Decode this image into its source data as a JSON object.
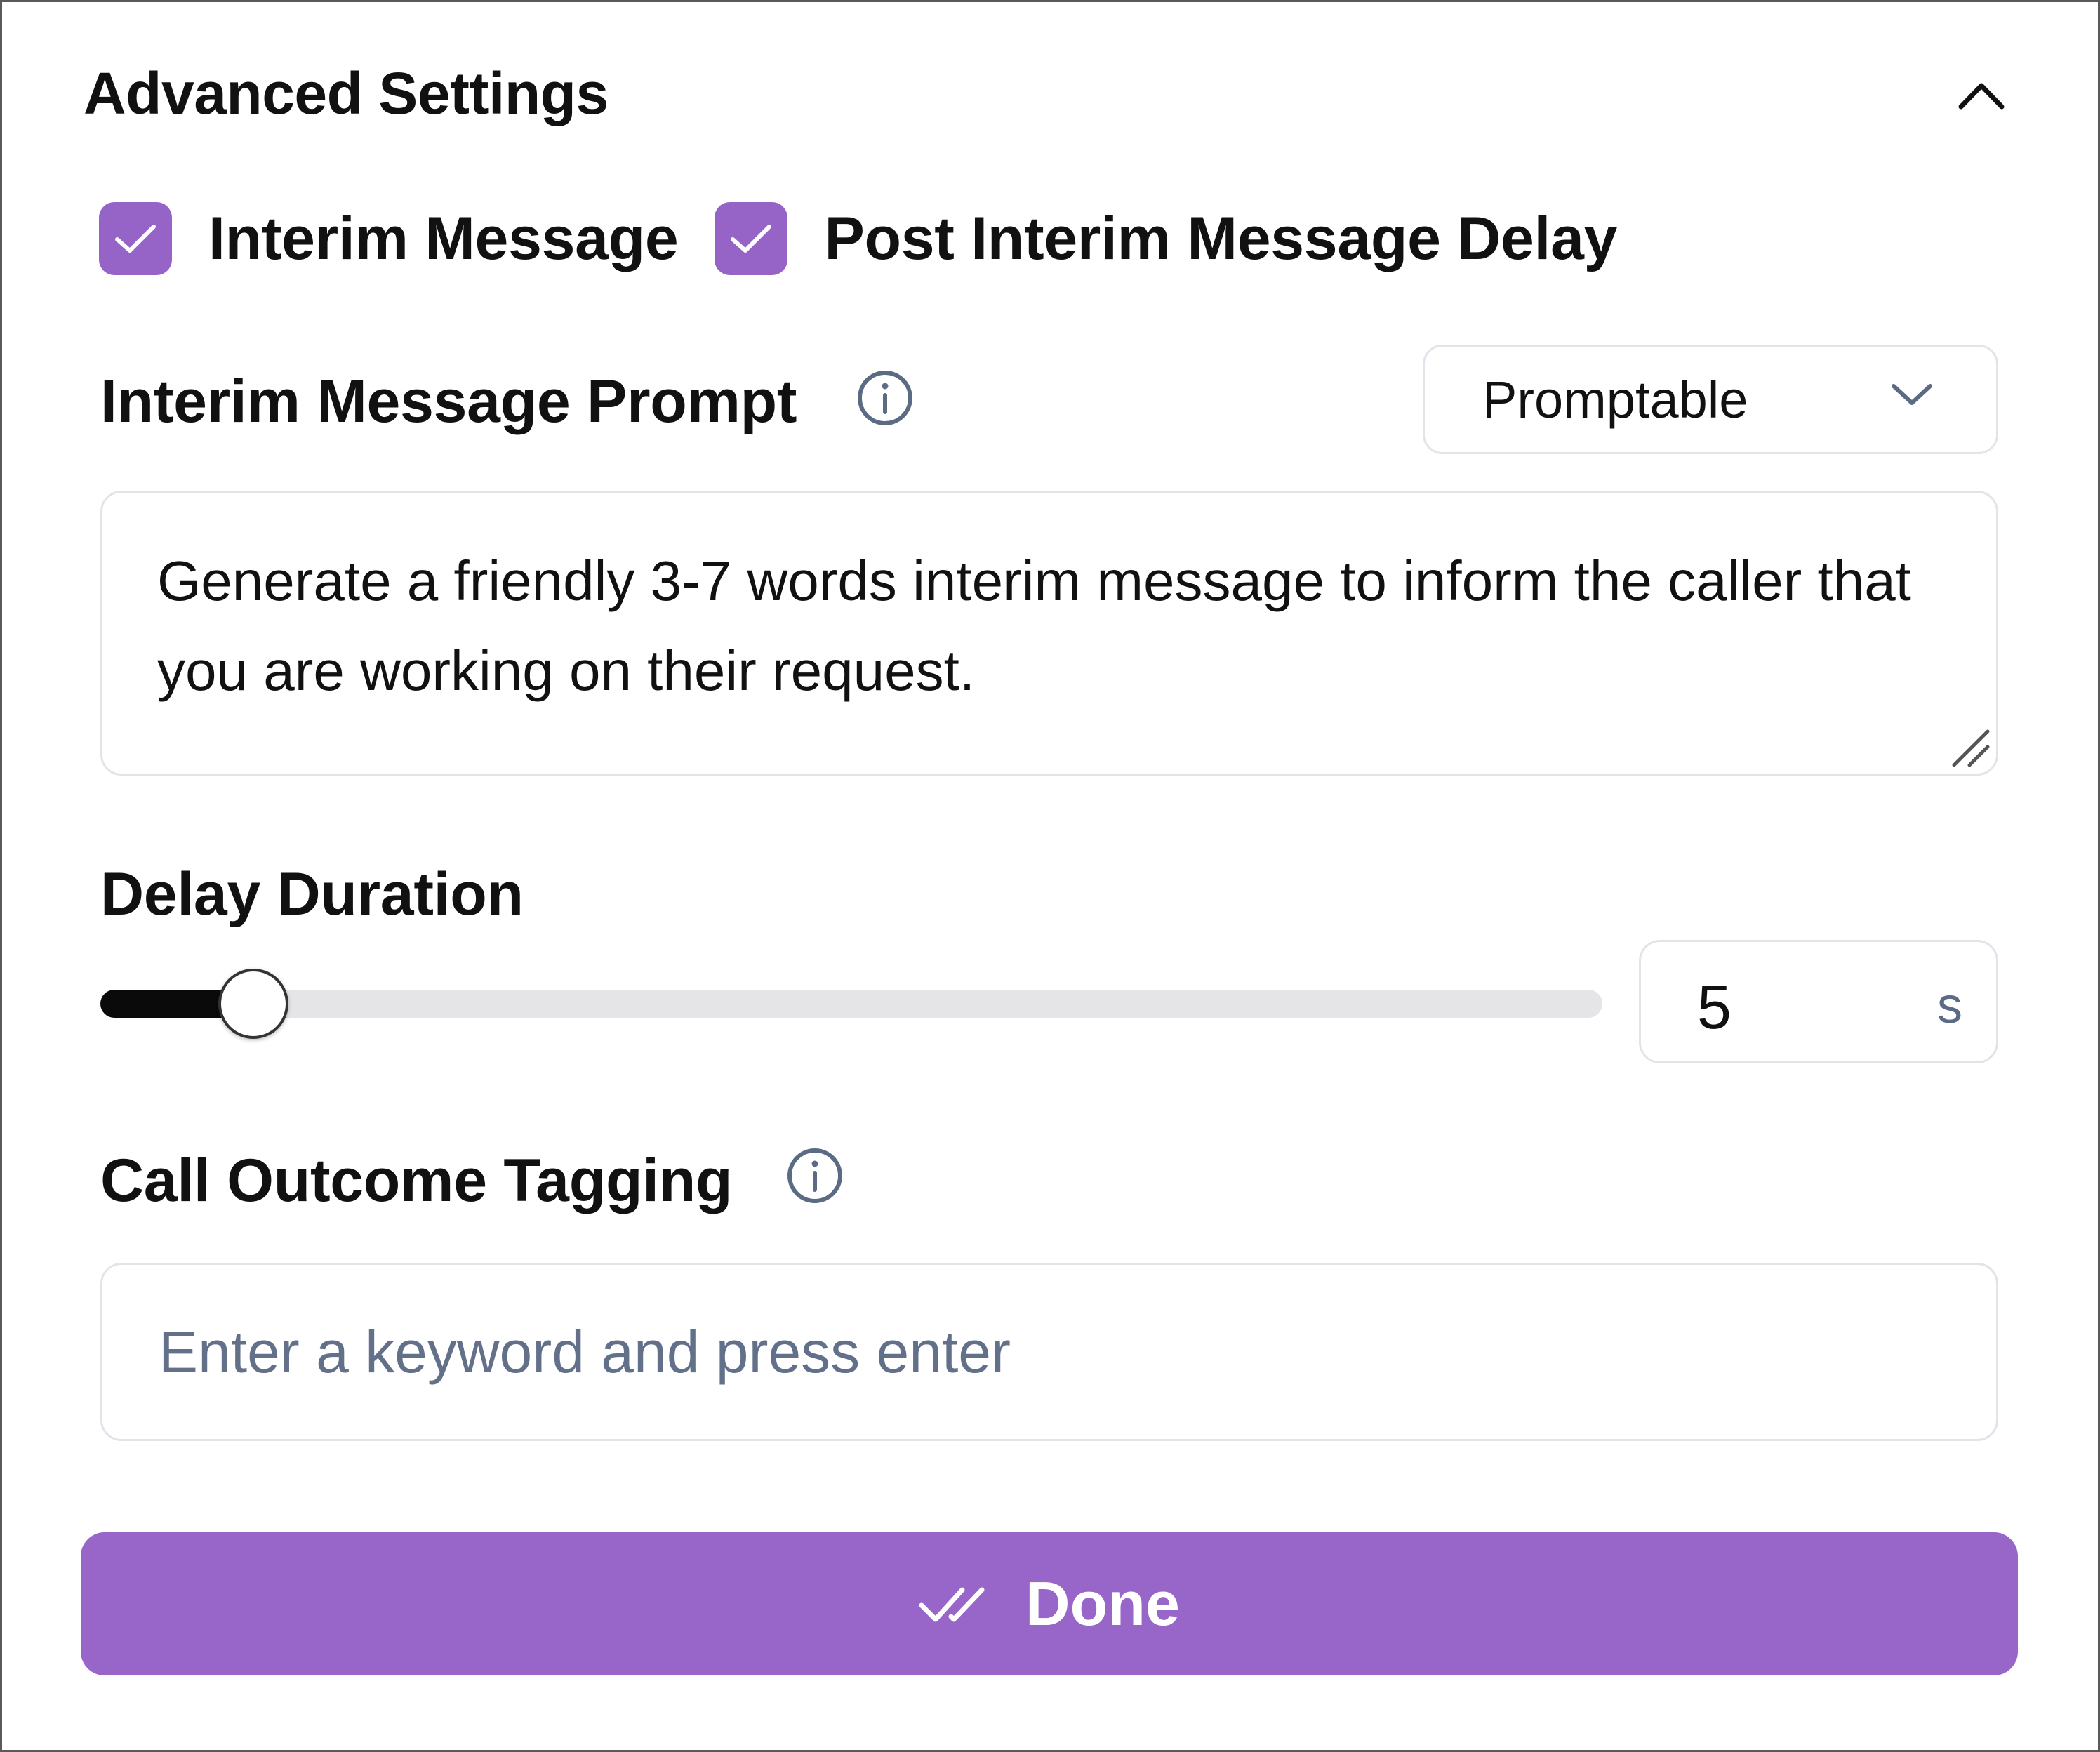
{
  "header": {
    "title": "Advanced Settings"
  },
  "checkboxes": [
    {
      "label": "Interim Message",
      "checked": true
    },
    {
      "label": "Post Interim Message Delay",
      "checked": true
    }
  ],
  "prompt": {
    "label": "Interim Message Prompt",
    "mode": "Promptable",
    "text": "Generate a friendly 3-7 words interim message to inform the caller that you are working on their request."
  },
  "delay": {
    "label": "Delay Duration",
    "value": "5",
    "unit": "s",
    "fraction": 0.102
  },
  "tagging": {
    "label": "Call Outcome Tagging",
    "placeholder": "Enter a keyword and press enter"
  },
  "done": {
    "label": "Done"
  },
  "colors": {
    "accent": "#9766c8",
    "checkbox": "#9664c6"
  }
}
